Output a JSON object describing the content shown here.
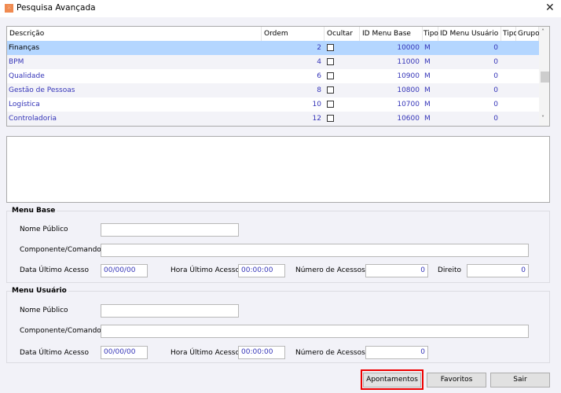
{
  "window": {
    "title": "Pesquisa Avançada",
    "icon": "app-logo-icon",
    "close": "✕"
  },
  "grid": {
    "columns": [
      "Descrição",
      "Ordem",
      "Ocultar",
      "ID Menu Base",
      "Tipo",
      "ID Menu Usuário",
      "Tipo",
      "Grupo"
    ],
    "rows": [
      {
        "descricao": "Finanças",
        "ordem": "2",
        "id_base": "10000",
        "tipo": "M",
        "id_usuario": "0",
        "selected": true
      },
      {
        "descricao": "BPM",
        "ordem": "4",
        "id_base": "11000",
        "tipo": "M",
        "id_usuario": "0"
      },
      {
        "descricao": "Qualidade",
        "ordem": "6",
        "id_base": "10900",
        "tipo": "M",
        "id_usuario": "0"
      },
      {
        "descricao": "Gestão de Pessoas",
        "ordem": "8",
        "id_base": "10800",
        "tipo": "M",
        "id_usuario": "0"
      },
      {
        "descricao": "Logística",
        "ordem": "10",
        "id_base": "10700",
        "tipo": "M",
        "id_usuario": "0"
      },
      {
        "descricao": "Controladoria",
        "ordem": "12",
        "id_base": "10600",
        "tipo": "M",
        "id_usuario": "0"
      }
    ],
    "scroll_up": "˄",
    "scroll_down": "˅"
  },
  "menu_base": {
    "title": "Menu Base",
    "nome_publico_label": "Nome Público",
    "nome_publico": "",
    "componente_label": "Componente/Comando",
    "componente": "",
    "data_label": "Data Último Acesso",
    "data": "00/00/00",
    "hora_label": "Hora Último Acesso",
    "hora": "00:00:00",
    "num_label": "Número de Acessos",
    "num": "0",
    "direito_label": "Direito",
    "direito": "0"
  },
  "menu_usuario": {
    "title": "Menu Usuário",
    "nome_publico_label": "Nome Público",
    "nome_publico": "",
    "componente_label": "Componente/Comando",
    "componente": "",
    "data_label": "Data Último Acesso",
    "data": "00/00/00",
    "hora_label": "Hora Último Acesso",
    "hora": "00:00:00",
    "num_label": "Número de Acessos",
    "num": "0"
  },
  "buttons": {
    "apontamentos": "Apontamentos",
    "favoritos": "Favoritos",
    "sair": "Sair"
  },
  "colors": {
    "highlight": "#ee0000",
    "selection": "#b4d6ff",
    "value_text": "#3535b8"
  }
}
